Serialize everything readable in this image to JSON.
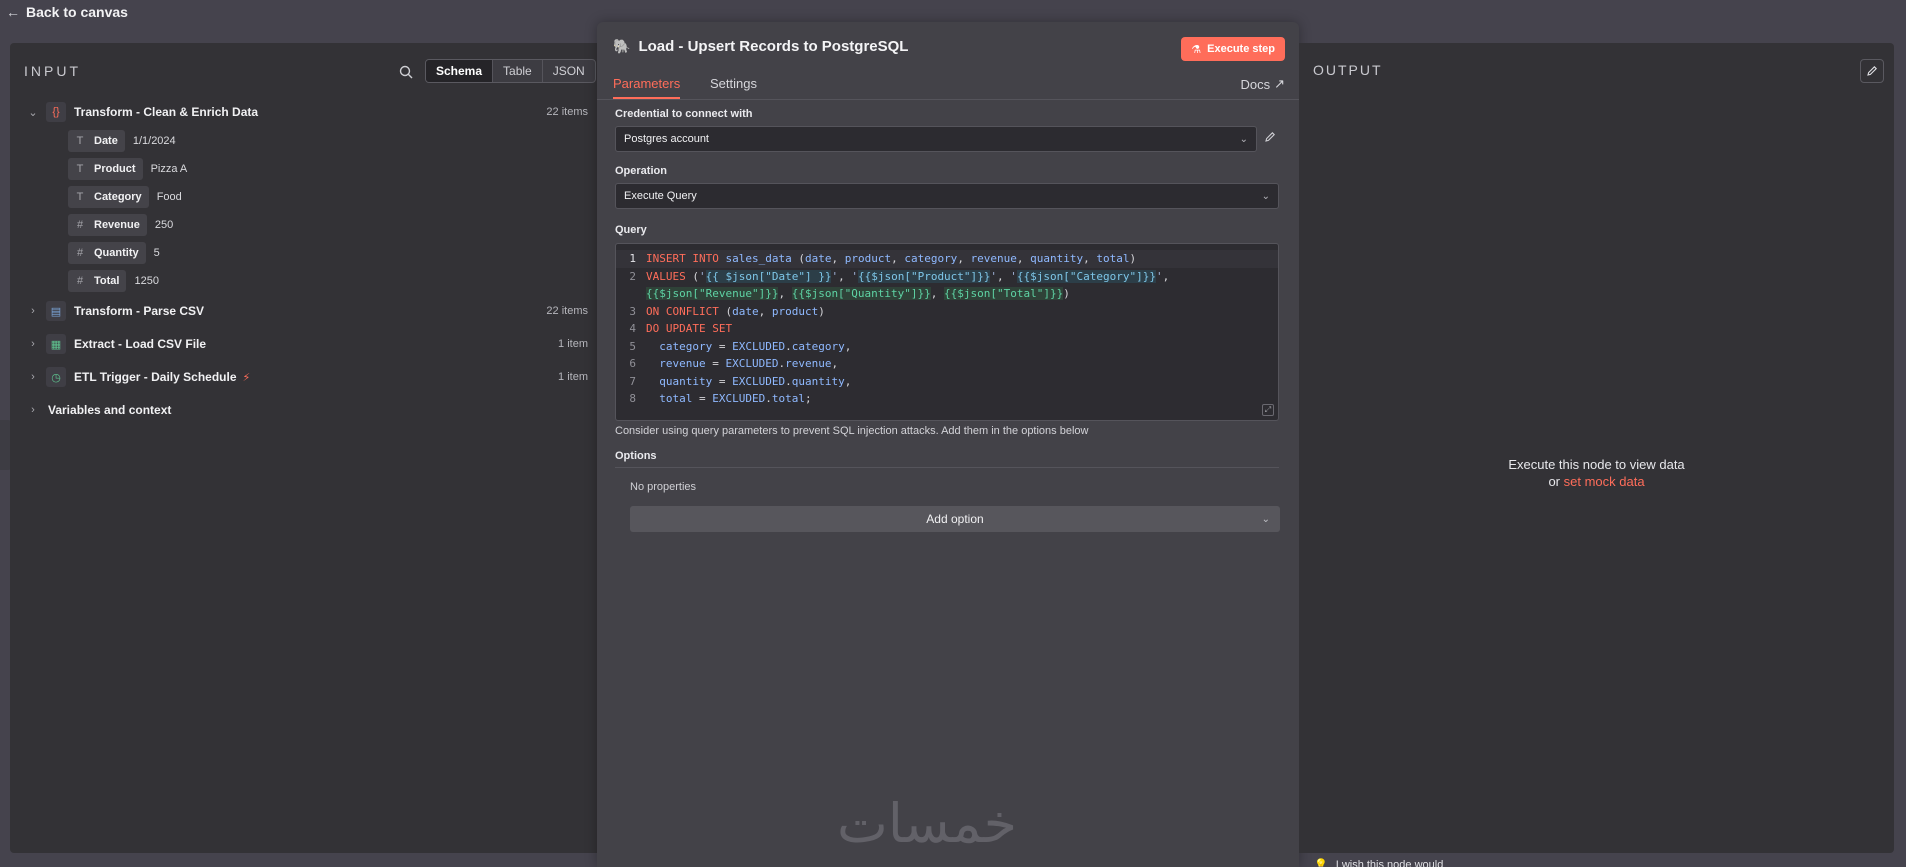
{
  "top": {
    "back_label": "Back to canvas"
  },
  "input": {
    "header": "INPUT",
    "views": [
      "Schema",
      "Table",
      "JSON"
    ],
    "active_view": "Schema",
    "nodes": [
      {
        "title": "Transform - Clean & Enrich Data",
        "count": "22 items",
        "expanded": true,
        "icon": "code-braces-icon",
        "fields": [
          {
            "type": "T",
            "name": "Date",
            "value": "1/1/2024"
          },
          {
            "type": "T",
            "name": "Product",
            "value": "Pizza A"
          },
          {
            "type": "T",
            "name": "Category",
            "value": "Food"
          },
          {
            "type": "#",
            "name": "Revenue",
            "value": "250"
          },
          {
            "type": "#",
            "name": "Quantity",
            "value": "5"
          },
          {
            "type": "#",
            "name": "Total",
            "value": "1250"
          }
        ]
      },
      {
        "title": "Transform - Parse CSV",
        "count": "22 items",
        "icon": "csv-icon"
      },
      {
        "title": "Extract - Load CSV File",
        "count": "1 item",
        "icon": "file-icon"
      },
      {
        "title": "ETL Trigger - Daily Schedule",
        "count": "1 item",
        "icon": "clock-icon",
        "badge": "⚡"
      }
    ],
    "variables_label": "Variables and context"
  },
  "node": {
    "title": "Load - Upsert Records to PostgreSQL",
    "execute_label": "Execute step",
    "tabs": [
      "Parameters",
      "Settings"
    ],
    "active_tab": "Parameters",
    "docs_label": "Docs",
    "credential_label": "Credential to connect with",
    "credential_value": "Postgres account",
    "operation_label": "Operation",
    "operation_value": "Execute Query",
    "query_label": "Query",
    "query_lines": [
      {
        "n": "1",
        "active": true
      },
      {
        "n": "2"
      },
      {
        "n": ""
      },
      {
        "n": "3"
      },
      {
        "n": "4"
      },
      {
        "n": "5"
      },
      {
        "n": "6"
      },
      {
        "n": "7"
      },
      {
        "n": "8"
      }
    ],
    "hint": "Consider using query parameters to prevent SQL injection attacks. Add them in the options below",
    "options_label": "Options",
    "no_properties": "No properties",
    "add_option_label": "Add option",
    "watermark": "خمسات"
  },
  "output": {
    "header": "OUTPUT",
    "empty_line1": "Execute this node to view data",
    "empty_or": "or",
    "mock_link": "set mock data",
    "feedback": "I wish this node would"
  },
  "colors": {
    "accent": "#ff6d5a",
    "panel": "#333236",
    "background": "#45434d"
  }
}
